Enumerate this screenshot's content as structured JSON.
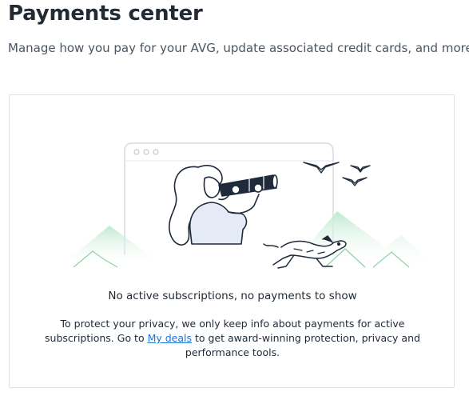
{
  "header": {
    "title": "Payments center",
    "subtitle": "Manage how you pay for your AVG, update associated credit cards, and more."
  },
  "empty_state": {
    "heading": "No active subscriptions, no payments to show",
    "desc_line1": "To protect your privacy, we only keep info about payments for active",
    "desc_before_link": "subscriptions. Go to ",
    "link_label": "My deals",
    "desc_after_link": " to get award-winning protection, privacy and",
    "desc_line3": "performance tools."
  },
  "illustration": {
    "colors": {
      "mountain": "#cfeedd",
      "line": "#1f2a3a",
      "tint": "#e4ebf7"
    }
  }
}
